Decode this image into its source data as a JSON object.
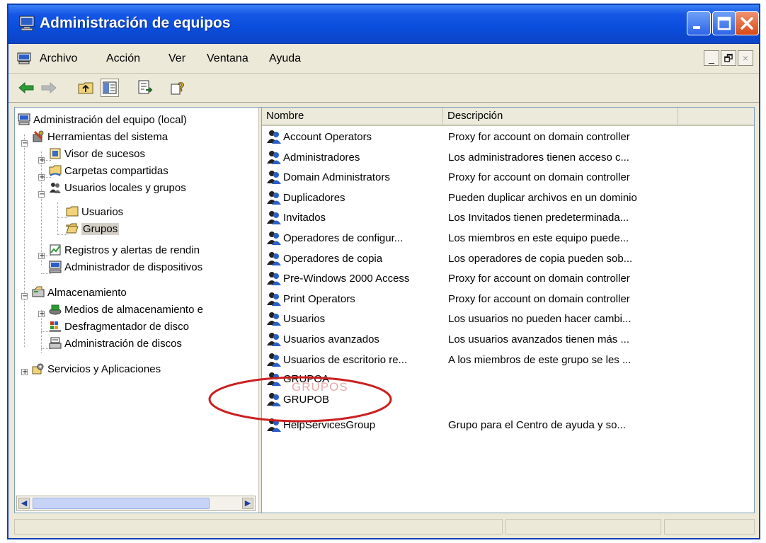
{
  "window": {
    "title": "Administración de equipos"
  },
  "menu": {
    "items": [
      "Archivo",
      "Acción",
      "Ver",
      "Ventana",
      "Ayuda"
    ],
    "mdi_controls": [
      "_",
      "🗗",
      "×"
    ]
  },
  "toolbar": {
    "icons": [
      "back-arrow-icon",
      "forward-arrow-icon",
      "up-folder-icon",
      "show-hide-tree-icon",
      "export-list-icon",
      "help-icon"
    ]
  },
  "tree": {
    "nodes": [
      {
        "label": "Administración del equipo (local)",
        "icon": "computer-icon"
      },
      {
        "label": "Herramientas del sistema",
        "icon": "tools-icon"
      },
      {
        "label": "Visor de sucesos",
        "icon": "event-viewer-icon"
      },
      {
        "label": "Carpetas compartidas",
        "icon": "shared-folder-icon"
      },
      {
        "label": "Usuarios locales y grupos",
        "icon": "users-groups-icon"
      },
      {
        "label": "Usuarios",
        "icon": "folder-icon"
      },
      {
        "label": "Grupos",
        "icon": "open-folder-icon"
      },
      {
        "label": "Registros y alertas de rendin",
        "icon": "performance-logs-icon"
      },
      {
        "label": "Administrador de dispositivos",
        "icon": "device-manager-icon"
      },
      {
        "label": "Almacenamiento",
        "icon": "storage-icon"
      },
      {
        "label": "Medios de almacenamiento e",
        "icon": "removable-storage-icon"
      },
      {
        "label": "Desfragmentador de disco",
        "icon": "defrag-icon"
      },
      {
        "label": "Administración de discos",
        "icon": "disk-management-icon"
      },
      {
        "label": "Servicios y Aplicaciones",
        "icon": "services-icon"
      }
    ]
  },
  "list": {
    "columns": [
      "Nombre",
      "Descripción"
    ],
    "rows": [
      {
        "name": "Account Operators",
        "desc": "Proxy for account on domain controller"
      },
      {
        "name": "Administradores",
        "desc": "Los administradores tienen acceso c..."
      },
      {
        "name": "Domain Administrators",
        "desc": "Proxy for account on domain controller"
      },
      {
        "name": "Duplicadores",
        "desc": "Pueden duplicar archivos en un dominio"
      },
      {
        "name": "Invitados",
        "desc": "Los Invitados tienen predeterminada..."
      },
      {
        "name": "Operadores de configur...",
        "desc": "Los miembros en este equipo puede..."
      },
      {
        "name": "Operadores de copia",
        "desc": "Los operadores de copia pueden sob..."
      },
      {
        "name": "Pre-Windows 2000 Access",
        "desc": "Proxy for account on domain controller"
      },
      {
        "name": "Print Operators",
        "desc": "Proxy for account on domain controller"
      },
      {
        "name": "Usuarios",
        "desc": "Los usuarios no pueden hacer cambi..."
      },
      {
        "name": "Usuarios avanzados",
        "desc": "Los usuarios avanzados tienen más ..."
      },
      {
        "name": "Usuarios de escritorio re...",
        "desc": "A los miembros de este grupo se les ..."
      },
      {
        "name": "GRUPOA",
        "desc": ""
      },
      {
        "name": "GRUPOB",
        "desc": ""
      },
      {
        "name": "HelpServicesGroup",
        "desc": "Grupo para el Centro de ayuda y so..."
      }
    ]
  },
  "annotation": {
    "ghost_text": "GRUPOS",
    "color": "#cc1f1f"
  },
  "colors": {
    "titlebar": "#0a4ddb",
    "close_button": "#d84a18",
    "face": "#ece9d8"
  }
}
